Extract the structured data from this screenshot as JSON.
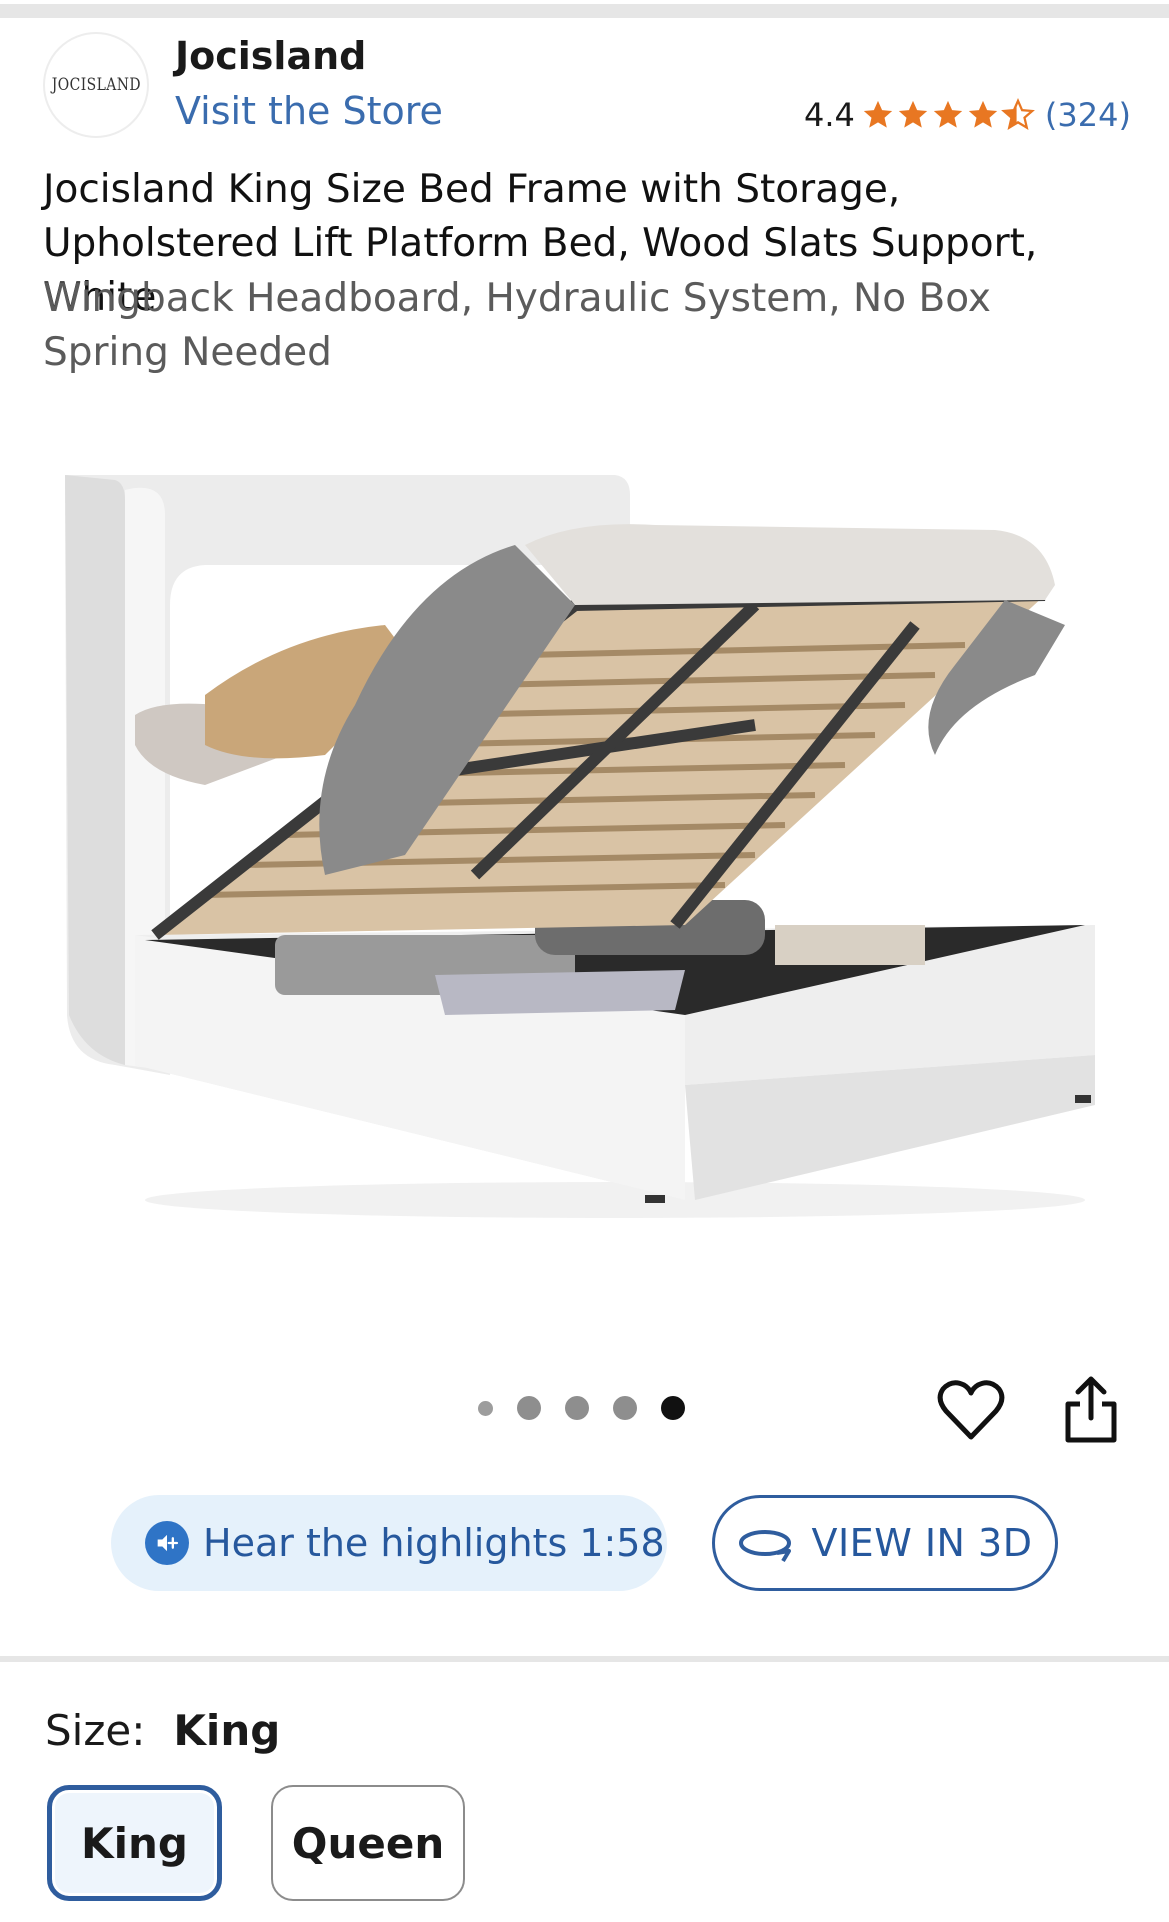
{
  "store": {
    "logo_text": "JOCISLAND",
    "name": "Jocisland",
    "visit_label": "Visit the Store"
  },
  "rating": {
    "value": "4.4",
    "stars_filled": 4.4,
    "stars_max": 5,
    "count_label": "(324)",
    "star_color": "#e87722"
  },
  "product": {
    "title": "Jocisland King Size Bed Frame with Storage, Upholstered Lift Platform Bed, Wood Slats Support, White",
    "subtitle": "Wingback Headboard, Hydraulic System, No Box Spring Needed"
  },
  "carousel": {
    "total_images": 5,
    "active_index": 4
  },
  "actions": {
    "favorite_icon": "heart-outline-icon",
    "share_icon": "share-icon"
  },
  "buttons": {
    "hear_highlights": "Hear the highlights 1:58",
    "view_3d": "VIEW IN 3D"
  },
  "size": {
    "label": "Size:",
    "selected": "King",
    "options": [
      "King",
      "Queen"
    ]
  },
  "colors": {
    "link": "#3a6cae",
    "accent": "#2f5d9e",
    "pill_bg": "#e5f1fb"
  }
}
